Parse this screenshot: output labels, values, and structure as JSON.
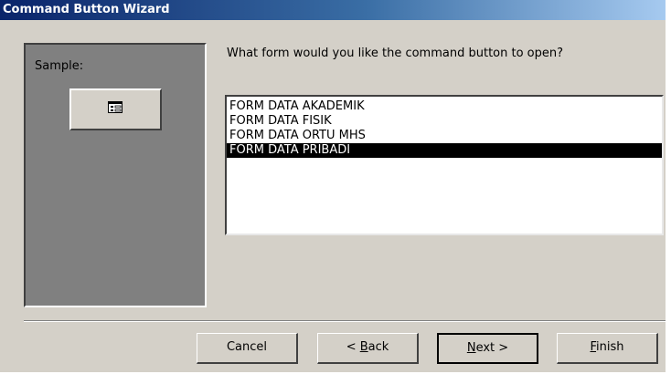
{
  "window": {
    "title": "Command Button Wizard"
  },
  "sample": {
    "label": "Sample:",
    "button_icon": "form-icon"
  },
  "question": "What form would you like the command button to open?",
  "forms_list": {
    "items": [
      "FORM DATA AKADEMIK",
      "FORM DATA FISIK",
      "FORM DATA ORTU MHS",
      "FORM DATA PRIBADI"
    ],
    "selected": "FORM DATA PRIBADI"
  },
  "buttons": {
    "cancel": "Cancel",
    "back": {
      "prefix": "< ",
      "mnemonic": "B",
      "rest": "ack"
    },
    "next": {
      "prefix": "",
      "mnemonic": "N",
      "rest": "ext >"
    },
    "finish": {
      "prefix": "",
      "mnemonic": "F",
      "rest": "inish"
    }
  },
  "colors": {
    "titlebar_start": "#0a246a",
    "titlebar_end": "#a6caf0",
    "dialog_face": "#d4d0c8",
    "sample_panel": "#808080",
    "selection": "#000000"
  }
}
